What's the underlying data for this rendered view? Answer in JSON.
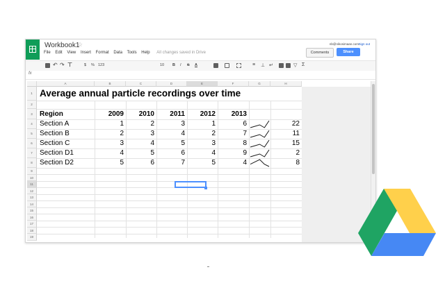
{
  "app": {
    "doc_title": "Workbook1",
    "menu": [
      "File",
      "Edit",
      "View",
      "Insert",
      "Format",
      "Data",
      "Tools",
      "Help"
    ],
    "save_status": "All changes saved in Drive",
    "account_email": "nb@nikosimaan.com",
    "signout_label": "Sign out",
    "comments_label": "Comments",
    "share_label": "Share"
  },
  "toolbar": {
    "currency": "$",
    "percent": "%",
    "number_format": "123",
    "font_size": "10",
    "bold": "B",
    "italic": "I",
    "strike": "S",
    "text_color": "A",
    "sigma": "Σ"
  },
  "formula_bar": {
    "fx": "fx"
  },
  "columns": [
    "A",
    "B",
    "C",
    "D",
    "E",
    "F",
    "G",
    "H"
  ],
  "rows": [
    "1",
    "2",
    "3",
    "4",
    "5",
    "6",
    "7",
    "8",
    "9",
    "10",
    "11",
    "12",
    "13",
    "14",
    "15",
    "16",
    "17",
    "18",
    "19"
  ],
  "sheet": {
    "title": "Average annual particle recordings over time",
    "header": [
      "Region",
      "2009",
      "2010",
      "2011",
      "2012",
      "2013"
    ],
    "data": [
      {
        "region": "Section A",
        "values": [
          1,
          2,
          3,
          1,
          6
        ],
        "total": 22
      },
      {
        "region": "Section B",
        "values": [
          2,
          3,
          4,
          2,
          7
        ],
        "total": 11
      },
      {
        "region": "Section C",
        "values": [
          3,
          4,
          5,
          3,
          8
        ],
        "total": 15
      },
      {
        "region": "Section D1",
        "values": [
          4,
          5,
          6,
          4,
          9
        ],
        "total": 2
      },
      {
        "region": "Section D2",
        "values": [
          5,
          6,
          7,
          5,
          4
        ],
        "total": 8
      }
    ]
  },
  "colors": {
    "accent": "#4d90fe",
    "app_green": "#0f9d58",
    "drive_green": "#1fa463",
    "drive_yellow": "#ffd04b",
    "drive_blue": "#4688f4"
  },
  "icons": [
    "spreadsheet-logo-icon",
    "star-icon",
    "print-icon",
    "undo-icon",
    "redo-icon",
    "paint-format-icon",
    "google-drive-logo-icon"
  ]
}
